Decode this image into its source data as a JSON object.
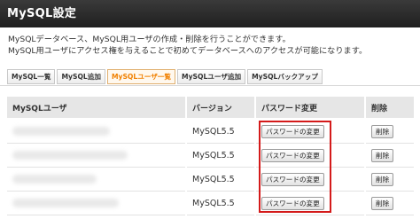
{
  "header": {
    "title": "MySQL設定"
  },
  "description": {
    "line1": "MySQLデータベース、MySQL用ユーザの作成・削除を行うことができます。",
    "line2": "MySQL用ユーザにアクセス権を与えることで初めてデータベースへのアクセスが可能になります。"
  },
  "tabs": [
    {
      "label": "MySQL一覧",
      "active": false
    },
    {
      "label": "MySQL追加",
      "active": false
    },
    {
      "label": "MySQLユーザ一覧",
      "active": true
    },
    {
      "label": "MySQLユーザ追加",
      "active": false
    },
    {
      "label": "MySQLバックアップ",
      "active": false
    }
  ],
  "table": {
    "headers": {
      "user": "MySQLユーザ",
      "version": "バージョン",
      "password": "パスワード変更",
      "delete": "削除"
    },
    "rows": [
      {
        "version": "MySQL5.5",
        "password_button": "パスワードの変更",
        "delete_button": "削除"
      },
      {
        "version": "MySQL5.5",
        "password_button": "パスワードの変更",
        "delete_button": "削除"
      },
      {
        "version": "MySQL5.5",
        "password_button": "パスワードの変更",
        "delete_button": "削除"
      },
      {
        "version": "MySQL5.5",
        "password_button": "パスワードの変更",
        "delete_button": "削除"
      }
    ]
  },
  "colors": {
    "title_bar": "#2a2a2a",
    "active_tab": "#f08000",
    "highlight_box": "#d41a1a"
  }
}
